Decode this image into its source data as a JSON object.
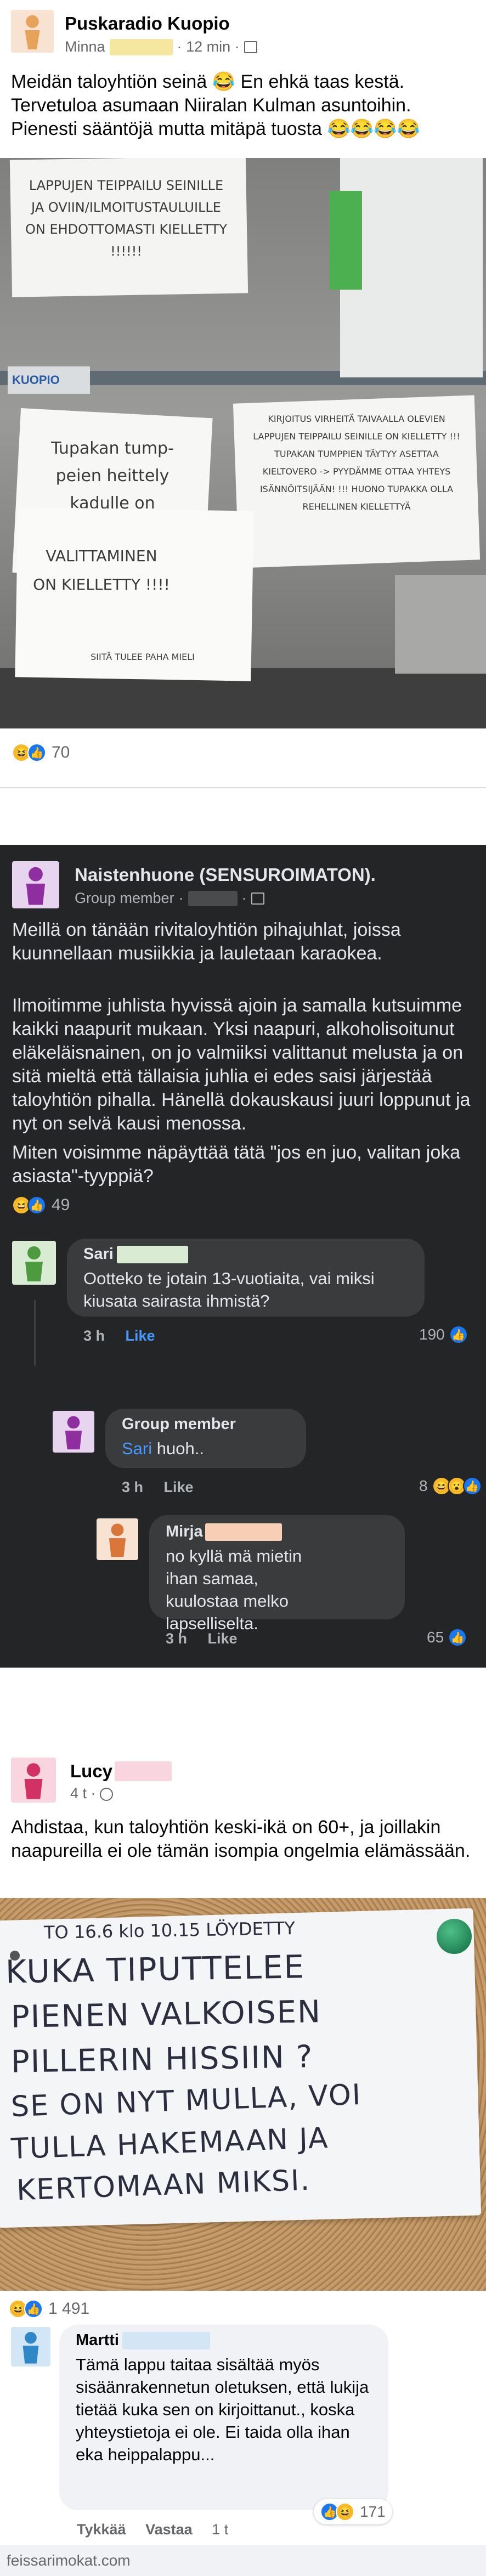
{
  "post1": {
    "author": "Puskaradio Kuopio",
    "sub_name": "Minna",
    "time": "12 min",
    "text": "Meidän taloyhtiön seinä 😂 En ehkä taas kestä. Tervetuloa asumaan Niiralan Kulman asuntoihin. Pienesti sääntöjä mutta mitäpä tuosta 😂😂😂😂",
    "notes": {
      "top_left": "LAPPUJEN TEIPPAILU SEINILLE JA OVIIN/ILMOITUSTAULUILLE ON EHDOTTOMASTI KIELLETTY !!!!!!",
      "mid_right": "KIRJOITUS VIRHEITÄ TAIVAALLA OLEVIEN LAPPUJEN TEIPPAILU SEINILLE ON KIELLETTY !!! TUPAKAN TUMPPIEN TÄYTYY ASETTAA KIELTOVERO -> PYYDÄMME OTTAA YHTEYS ISÄNNÖITSIJÄÄN! !!! HUONO TUPAKKA OLLA REHELLINEN KIELLETTYÄ",
      "tupakka": "Tupakan tump- peien heittely kadulle on kielletty!!!!!!",
      "valittaminen": "VALITTAMINEN ON KIELLETTY !!!!",
      "siita": "SIITÄ TULEE PAHA MIELI",
      "kuopio_logo": "KUOPIO"
    },
    "reactions": {
      "count": "70"
    }
  },
  "post2": {
    "author": "Naistenhuone (SENSUROIMATON).",
    "sub": "Group member",
    "paragraphs": [
      "Meillä on tänään rivitaloyhtiön pihajuhlat, joissa kuunnellaan musiikkia ja lauletaan karaokea.",
      "Ilmoitimme juhlista hyvissä ajoin ja samalla kutsuimme kaikki naapurit mukaan. Yksi naapuri, alkoholisoitunut eläkeläisnainen, on jo valmiiksi valittanut melusta ja on sitä mieltä että tällaisia juhlia ei edes saisi järjestää taloyhtiön pihalla. Hänellä dokauskausi juuri loppunut ja nyt on selvä kausi menossa.",
      "Miten voisimme näpäyttää tätä \"jos en juo, valitan joka asiasta\"-tyyppiä?"
    ],
    "reactions": {
      "count": "49"
    },
    "comments": [
      {
        "name": "Sari",
        "text": "Ootteko te jotain 13-vuotiaita, vai miksi kiusata sairasta ihmistä?",
        "time": "3 h",
        "like": "Like",
        "count": "190"
      },
      {
        "name": "Group member",
        "mention": "Sari",
        "text": "huoh..",
        "time": "3 h",
        "like": "Like",
        "count": "8"
      },
      {
        "name": "Mirja",
        "text": "no kyllä mä mietin ihan samaa, kuulostaa melko lapselliselta.",
        "time": "3 h",
        "like": "Like",
        "count": "65"
      }
    ]
  },
  "post3": {
    "author": "Lucy",
    "time": "4 t",
    "text": "Ahdistaa, kun taloyhtiön keski-ikä on 60+, ja joillakin naapureilla ei ole tämän isompia ongelmia elämässään.",
    "note_lines": [
      "TO 16.6 klo 10.15 LÖYDETTY",
      "KUKA TIPUTTELEE",
      "PIENEN VALKOISEN",
      "PILLERIN HISSIIN ?",
      "SE ON NYT MULLA, VOI",
      "TULLA HAKEMAAN JA",
      "KERTOMAAN MIKSI."
    ],
    "reactions": {
      "count": "1 491"
    },
    "comment": {
      "name": "Martti",
      "text": "Tämä lappu taitaa sisältää myös sisäänrakennetun oletuksen, että lukija tietää kuka sen on kirjoittanut., koska yhteystietoja ei ole. Ei taida olla ihan eka heippalappu...",
      "actions": [
        "Tykkää",
        "Vastaa",
        "1 t"
      ],
      "count": "171"
    }
  },
  "footer": {
    "site": "feissarimokat.com"
  }
}
